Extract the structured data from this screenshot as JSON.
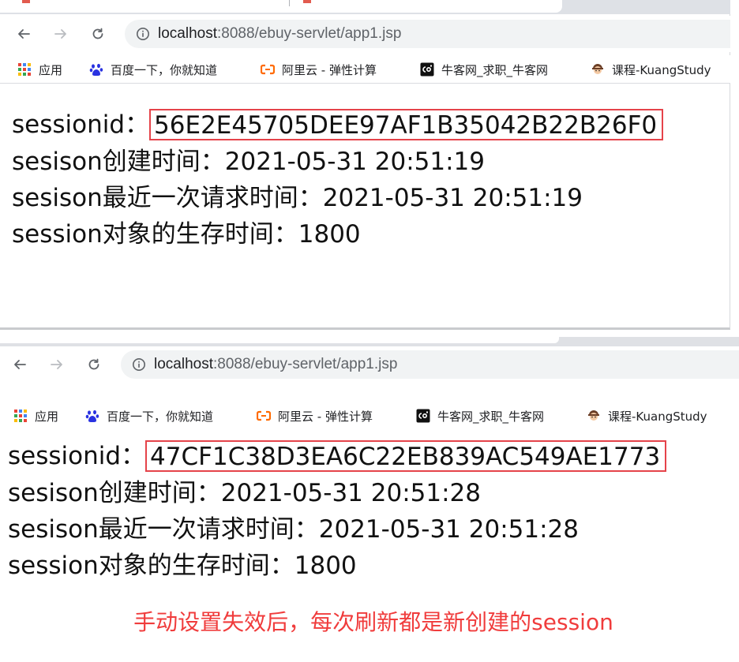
{
  "browser_top": {
    "address": {
      "host": "localhost",
      "path": ":8088/ebuy-servlet/app1.jsp"
    },
    "bookmarks": [
      {
        "icon": "apps-grid-icon",
        "label": "应用"
      },
      {
        "icon": "baidu-paw-icon",
        "label": "百度一下，你就知道"
      },
      {
        "icon": "aliyun-logo-icon",
        "label": "阿里云 - 弹性计算"
      },
      {
        "icon": "nowcoder-logo-icon",
        "label": "牛客网_求职_牛客网"
      },
      {
        "icon": "kuangstudy-avatar-icon",
        "label": "课程-KuangStudy"
      }
    ],
    "content": {
      "sessionid_label": "sessionid：",
      "sessionid_value": "56E2E45705DEE97AF1B35042B22B26F0",
      "created_line": "sesison创建时间：2021-05-31 20:51:19",
      "last_access_line": "sesison最近一次请求时间：2021-05-31 20:51:19",
      "timeout_line": "session对象的生存时间：1800"
    }
  },
  "browser_bottom": {
    "address": {
      "host": "localhost",
      "path": ":8088/ebuy-servlet/app1.jsp"
    },
    "bookmarks": [
      {
        "icon": "apps-grid-icon",
        "label": "应用"
      },
      {
        "icon": "baidu-paw-icon",
        "label": "百度一下，你就知道"
      },
      {
        "icon": "aliyun-logo-icon",
        "label": "阿里云 - 弹性计算"
      },
      {
        "icon": "nowcoder-logo-icon",
        "label": "牛客网_求职_牛客网"
      },
      {
        "icon": "kuangstudy-avatar-icon",
        "label": "课程-KuangStudy"
      }
    ],
    "content": {
      "sessionid_label": "sessionid：",
      "sessionid_value": "47CF1C38D3EA6C22EB839AC549AE1773",
      "created_line": "sesison创建时间：2021-05-31 20:51:28",
      "last_access_line": "sesison最近一次请求时间：2021-05-31 20:51:28",
      "timeout_line": "session对象的生存时间：1800"
    }
  },
  "annotation": "手动设置失效后，每次刷新都是新创建的session",
  "colors": {
    "highlight_box": "#e5434a",
    "annotation_text": "#f03c3c",
    "omnibox_bg": "#f1f3f4",
    "tab_strip": "#dee1e6"
  }
}
